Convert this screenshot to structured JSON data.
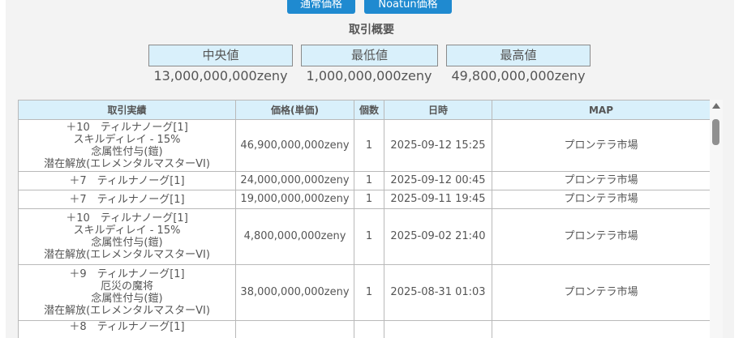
{
  "buttons": {
    "normal_price": "通常価格",
    "noatun_price": "Noatun価格"
  },
  "summary": {
    "title": "取引概要",
    "stats": [
      {
        "label": "中央値",
        "value": "13,000,000,000zeny"
      },
      {
        "label": "最低値",
        "value": "1,000,000,000zeny"
      },
      {
        "label": "最高値",
        "value": "49,800,000,000zeny"
      }
    ]
  },
  "table": {
    "headers": [
      "取引実績",
      "価格(単価)",
      "個数",
      "日時",
      "MAP"
    ],
    "rows": [
      {
        "item_lines": [
          "＋10　ティルナノーグ[1]",
          "スキルディレイ - 15%",
          "念属性付与(鎧)",
          "潜在解放(エレメンタルマスターVI)"
        ],
        "price": "46,900,000,000zeny",
        "qty": "1",
        "date": "2025-09-12 15:25",
        "map": "プロンテラ市場"
      },
      {
        "item_lines": [
          "＋7　ティルナノーグ[1]"
        ],
        "price": "24,000,000,000zeny",
        "qty": "1",
        "date": "2025-09-12 00:45",
        "map": "プロンテラ市場"
      },
      {
        "item_lines": [
          "＋7　ティルナノーグ[1]"
        ],
        "price": "19,000,000,000zeny",
        "qty": "1",
        "date": "2025-09-11 19:45",
        "map": "プロンテラ市場"
      },
      {
        "item_lines": [
          "＋10　ティルナノーグ[1]",
          "スキルディレイ - 15%",
          "念属性付与(鎧)",
          "潜在解放(エレメンタルマスターVI)"
        ],
        "price": "4,800,000,000zeny",
        "qty": "1",
        "date": "2025-09-02 21:40",
        "map": "プロンテラ市場"
      },
      {
        "item_lines": [
          "＋9　ティルナノーグ[1]",
          "厄災の魔将",
          "念属性付与(鎧)",
          "潜在解放(エレメンタルマスターVI)"
        ],
        "price": "38,000,000,000zeny",
        "qty": "1",
        "date": "2025-08-31 01:03",
        "map": "プロンテラ市場"
      },
      {
        "item_lines": [
          "＋8　ティルナノーグ[1]"
        ],
        "price": "",
        "qty": "",
        "date": "",
        "map": ""
      }
    ]
  }
}
